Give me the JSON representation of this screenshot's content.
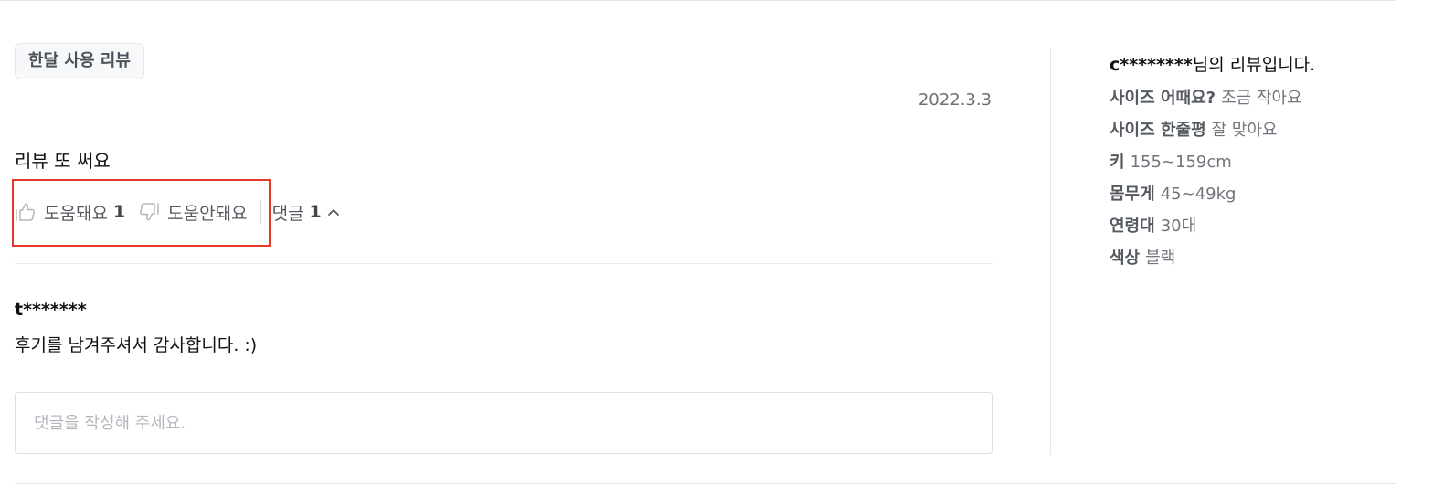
{
  "review": {
    "tag": "한달 사용 리뷰",
    "date": "2022.3.3",
    "text": "리뷰 또 써요",
    "actions": {
      "helpful_label": "도움돼요",
      "helpful_count": "1",
      "unhelpful_label": "도움안돼요",
      "comments_label": "댓글",
      "comments_count": "1",
      "thumbs_up_icon": "thumbs-up-icon",
      "thumbs_down_icon": "thumbs-down-icon",
      "toggle_icon": "chevron-up-icon"
    }
  },
  "reply": {
    "author": "t*******",
    "text": "후기를 남겨주셔서 감사합니다. :)"
  },
  "comment_input": {
    "value": "",
    "placeholder": "댓글을 작성해 주세요."
  },
  "reviewer": {
    "username": "c********",
    "title_suffix": "님의 리뷰입니다.",
    "attributes": [
      {
        "label": "사이즈 어때요?",
        "value": "조금 작아요"
      },
      {
        "label": "사이즈 한줄평",
        "value": "잘 맞아요"
      },
      {
        "label": "키",
        "value": "155~159cm"
      },
      {
        "label": "몸무게",
        "value": "45~49kg"
      },
      {
        "label": "연령대",
        "value": "30대"
      },
      {
        "label": "색상",
        "value": "블랙"
      }
    ]
  },
  "colors": {
    "highlight": "#e5392b",
    "tag_bg": "#f7f8fa",
    "text_muted": "#70757c"
  }
}
